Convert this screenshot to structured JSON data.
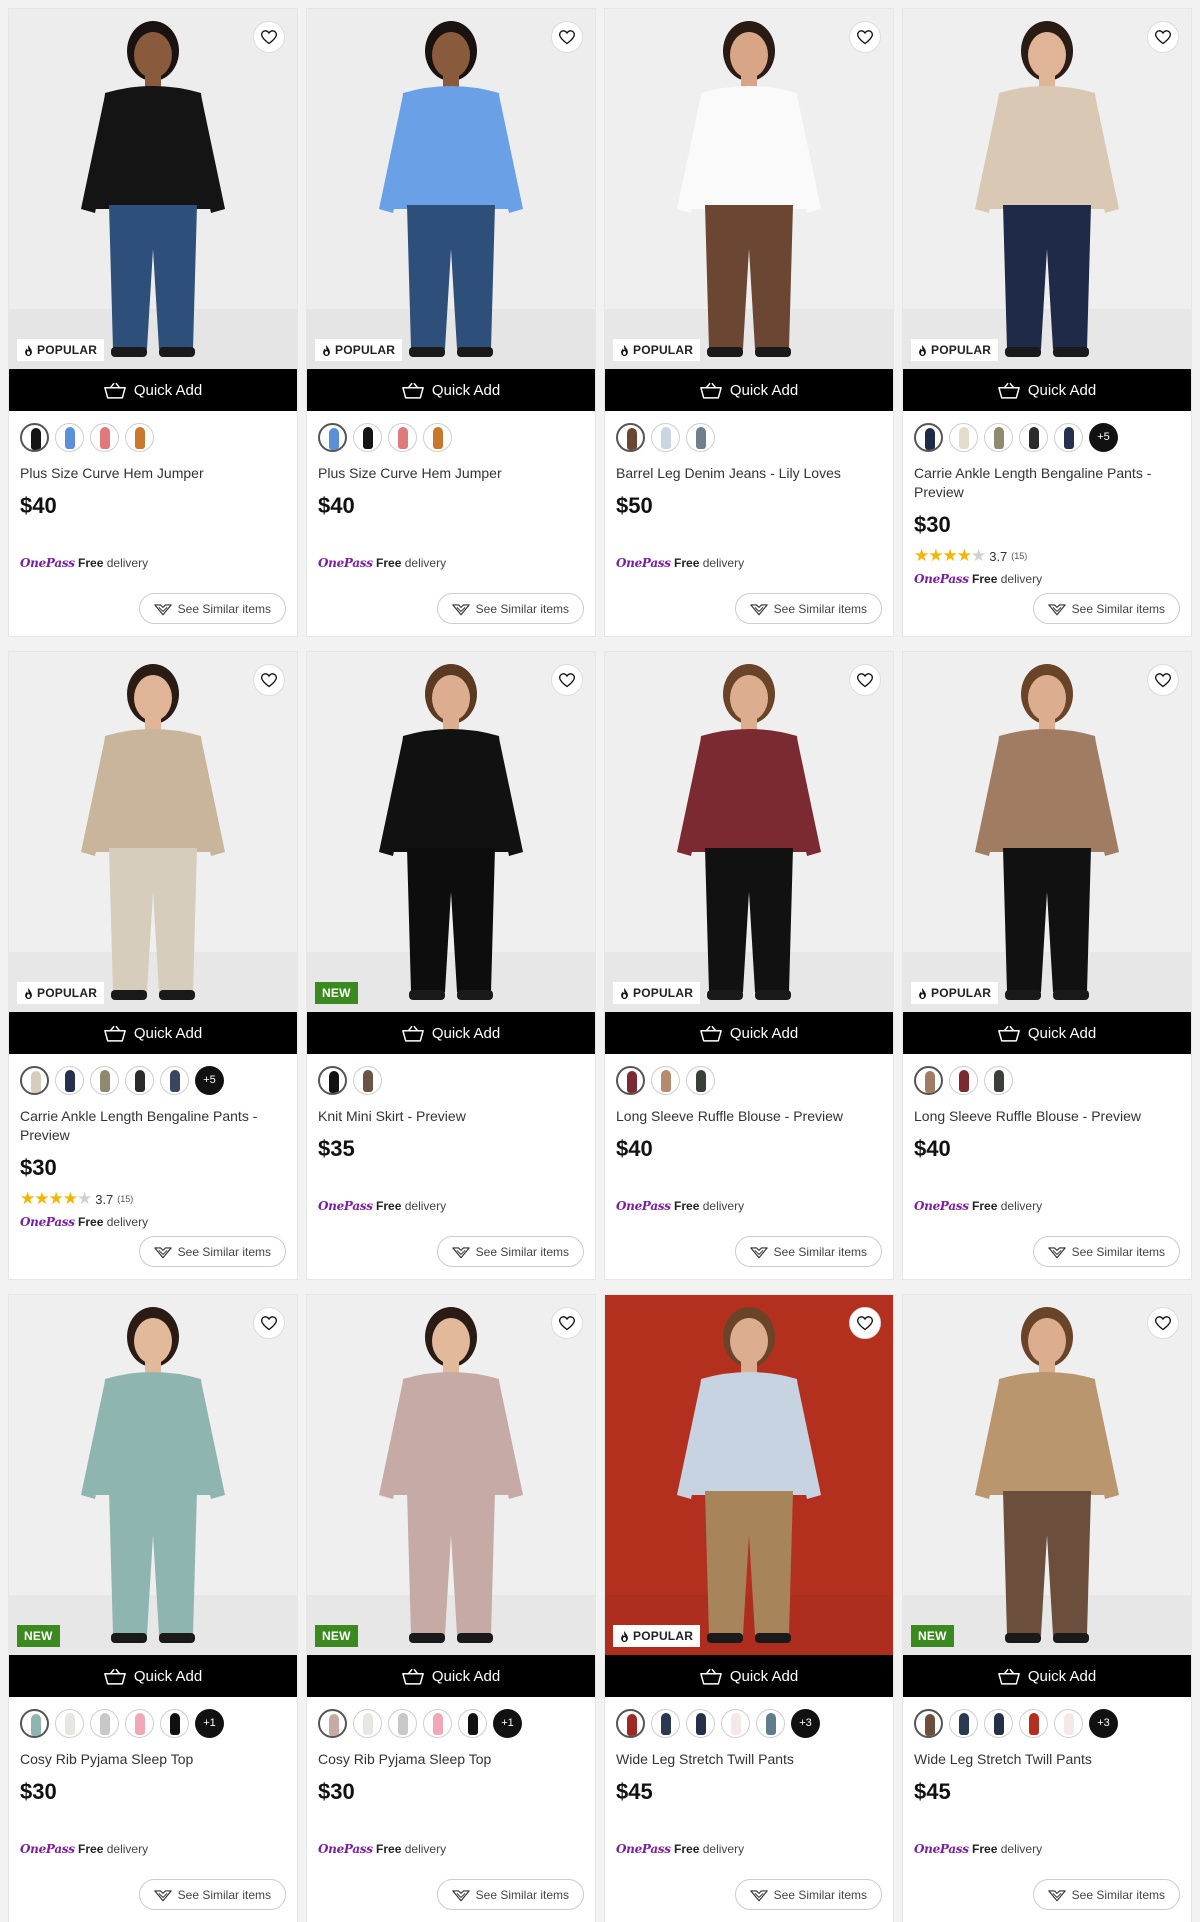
{
  "labels": {
    "quick_add": "Quick Add",
    "see_similar": "See Similar items",
    "onepass": "OnePass",
    "free": "Free",
    "delivery": " delivery"
  },
  "products": [
    {
      "name": "Plus Size Curve Hem Jumper",
      "price": "$40",
      "badge": "POPULAR",
      "badge_type": "popular",
      "bg": "#ededed",
      "top": "#141414",
      "bottom": "#2d4f79",
      "skin": "#8a5a3c",
      "hair": "#1a1210",
      "swatches": [
        "#141414",
        "#5b8fd8",
        "#e07a7a",
        "#c9772c"
      ],
      "more": ""
    },
    {
      "name": "Plus Size Curve Hem Jumper",
      "price": "$40",
      "badge": "POPULAR",
      "badge_type": "popular",
      "bg": "#ededed",
      "top": "#6aa1e6",
      "bottom": "#2d4f79",
      "skin": "#8a5a3c",
      "hair": "#1a1210",
      "swatches": [
        "#5b8fd8",
        "#141414",
        "#e07a7a",
        "#c9772c"
      ],
      "more": ""
    },
    {
      "name": "Barrel Leg Denim Jeans - Lily Loves",
      "price": "$50",
      "badge": "POPULAR",
      "badge_type": "popular",
      "bg": "#efefef",
      "top": "#fafafa",
      "bottom": "#6b4632",
      "skin": "#d8a587",
      "hair": "#2a1c14",
      "swatches": [
        "#6b4632",
        "#c9d5e3",
        "#6f7f8c"
      ],
      "more": ""
    },
    {
      "name": "Carrie Ankle Length Bengaline Pants - Preview",
      "price": "$30",
      "badge": "POPULAR",
      "badge_type": "popular",
      "bg": "#efefef",
      "top": "#d8c8b4",
      "bottom": "#1f2a48",
      "skin": "#e0b597",
      "hair": "#2a1c14",
      "swatches": [
        "#1f2a48",
        "#e3dccd",
        "#8f8a6f",
        "#2b2b2b",
        "#24304d"
      ],
      "more": "+5",
      "rating": "3.7",
      "rating_count": "(15)",
      "stars": 4
    },
    {
      "name": "Carrie Ankle Length Bengaline Pants - Preview",
      "price": "$30",
      "badge": "POPULAR",
      "badge_type": "popular",
      "bg": "#efefef",
      "top": "#c9b49c",
      "bottom": "#d6cdbd",
      "skin": "#e0b597",
      "hair": "#2a1c14",
      "swatches": [
        "#d6cdbd",
        "#24304d",
        "#8f8a6f",
        "#2b2b2b",
        "#3a4660"
      ],
      "more": "+5",
      "rating": "3.7",
      "rating_count": "(15)",
      "stars": 4
    },
    {
      "name": "Knit Mini Skirt - Preview",
      "price": "$35",
      "badge": "NEW",
      "badge_type": "new",
      "bg": "#efefef",
      "top": "#111111",
      "bottom": "#0d0d0d",
      "skin": "#dcae8f",
      "hair": "#5a3a22",
      "swatches": [
        "#111111",
        "#6b5443"
      ],
      "more": ""
    },
    {
      "name": "Long Sleeve Ruffle Blouse - Preview",
      "price": "$40",
      "badge": "POPULAR",
      "badge_type": "popular",
      "bg": "#efefef",
      "top": "#7a2a30",
      "bottom": "#111111",
      "skin": "#dcae8f",
      "hair": "#6a4428",
      "swatches": [
        "#7a2a30",
        "#b58a6e",
        "#3b3f3a"
      ],
      "more": ""
    },
    {
      "name": "Long Sleeve Ruffle Blouse - Preview",
      "price": "$40",
      "badge": "POPULAR",
      "badge_type": "popular",
      "bg": "#efefef",
      "top": "#a07c63",
      "bottom": "#111111",
      "skin": "#dcae8f",
      "hair": "#6a4428",
      "swatches": [
        "#a07c63",
        "#7a2a30",
        "#3b3f3a"
      ],
      "more": ""
    },
    {
      "name": "Cosy Rib Pyjama Sleep Top",
      "price": "$30",
      "badge": "NEW",
      "badge_type": "new",
      "bg": "#efefef",
      "top": "#8fb5b1",
      "bottom": "#8fb5b1",
      "skin": "#e3b99b",
      "hair": "#2a1c14",
      "swatches": [
        "#8fb5b1",
        "#e8e6e0",
        "#c8c8c8",
        "#f0a8b8",
        "#111111"
      ],
      "more": "+1"
    },
    {
      "name": "Cosy Rib Pyjama Sleep Top",
      "price": "$30",
      "badge": "NEW",
      "badge_type": "new",
      "bg": "#efefef",
      "top": "#c5aaa6",
      "bottom": "#c5aaa6",
      "skin": "#e3b99b",
      "hair": "#2a1c14",
      "swatches": [
        "#c5aaa6",
        "#e8e6e0",
        "#c8c8c8",
        "#f0a8b8",
        "#111111"
      ],
      "more": "+1"
    },
    {
      "name": "Wide Leg Stretch Twill Pants",
      "price": "$45",
      "badge": "POPULAR",
      "badge_type": "popular",
      "bg": "#b3301f",
      "top": "#c7d3e0",
      "bottom": "#a7845a",
      "skin": "#dcae8f",
      "hair": "#6a4428",
      "swatches": [
        "#9c2a22",
        "#2b3950",
        "#243047",
        "#f4e9e6",
        "#5f7d8c"
      ],
      "more": "+3"
    },
    {
      "name": "Wide Leg Stretch Twill Pants",
      "price": "$45",
      "badge": "NEW",
      "badge_type": "new",
      "bg": "#efefef",
      "top": "#b9966e",
      "bottom": "#6b4e3b",
      "skin": "#dcae8f",
      "hair": "#6a4428",
      "swatches": [
        "#6b4e3b",
        "#2b3950",
        "#243047",
        "#b3301f",
        "#f4e9e6"
      ],
      "more": "+3"
    }
  ]
}
